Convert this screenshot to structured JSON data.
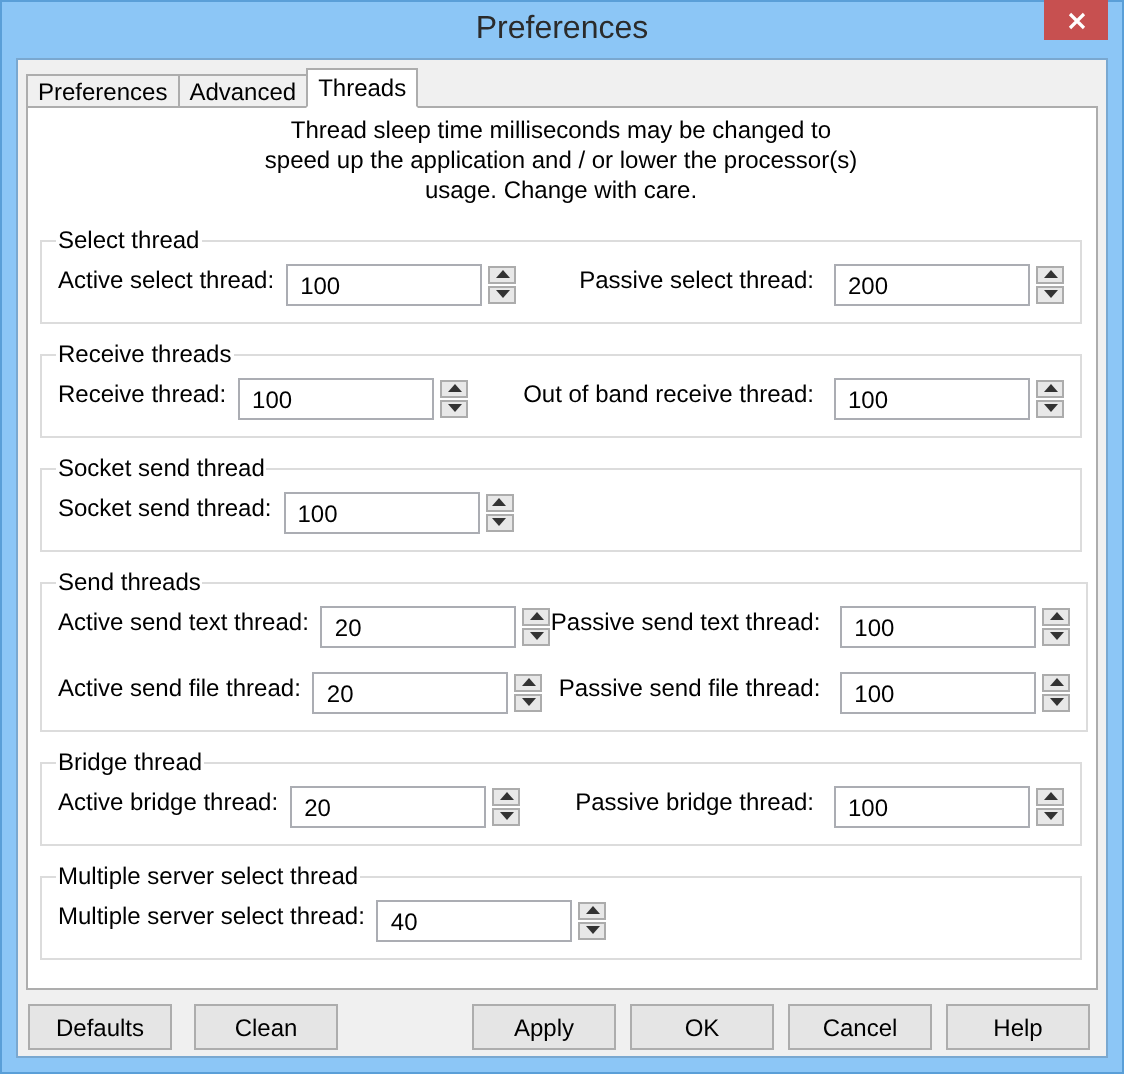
{
  "window": {
    "title": "Preferences"
  },
  "tabs": [
    {
      "label": "Preferences",
      "selected": false
    },
    {
      "label": "Advanced",
      "selected": false
    },
    {
      "label": "Threads",
      "selected": true
    }
  ],
  "description": "Thread sleep time milliseconds may be changed to speed up the application and / or lower the processor(s) usage.  Change with care.",
  "groups": [
    {
      "title": "Select thread",
      "rows": [
        [
          {
            "label": "Active select thread:",
            "value": "100"
          },
          {
            "label": "Passive select thread:",
            "value": "200"
          }
        ]
      ]
    },
    {
      "title": "Receive threads",
      "rows": [
        [
          {
            "label": "Receive thread:",
            "value": "100"
          },
          {
            "label": "Out of band receive thread:",
            "value": "100"
          }
        ]
      ]
    },
    {
      "title": "Socket send thread",
      "rows": [
        [
          {
            "label": "Socket send thread:",
            "value": "100"
          }
        ]
      ]
    },
    {
      "title": "Send threads",
      "rows": [
        [
          {
            "label": "Active send text thread:",
            "value": "20"
          },
          {
            "label": "Passive send text thread:",
            "value": "100"
          }
        ],
        [
          {
            "label": "Active send file thread:",
            "value": "20"
          },
          {
            "label": "Passive send file thread:",
            "value": "100"
          }
        ]
      ]
    },
    {
      "title": "Bridge thread",
      "rows": [
        [
          {
            "label": "Active bridge thread:",
            "value": "20"
          },
          {
            "label": "Passive bridge thread:",
            "value": "100"
          }
        ]
      ]
    },
    {
      "title": "Multiple server select thread",
      "rows": [
        [
          {
            "label": "Multiple server select thread:",
            "value": "40"
          }
        ]
      ]
    }
  ],
  "buttons_left": [
    "Defaults",
    "Clean"
  ],
  "buttons_right": [
    "Apply",
    "OK",
    "Cancel",
    "Help"
  ]
}
